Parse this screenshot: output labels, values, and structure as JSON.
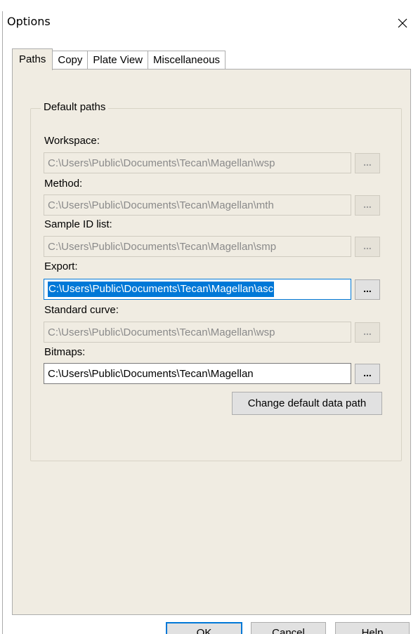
{
  "window": {
    "title": "Options",
    "close_glyph": "✕"
  },
  "tabs": [
    {
      "label": "Paths",
      "active": true
    },
    {
      "label": "Copy",
      "active": false
    },
    {
      "label": "Plate View",
      "active": false
    },
    {
      "label": "Miscellaneous",
      "active": false
    }
  ],
  "group": {
    "label": "Default paths"
  },
  "fields": {
    "workspace": {
      "label": "Workspace:",
      "value": "C:\\Users\\Public\\Documents\\Tecan\\Magellan\\wsp",
      "enabled": false
    },
    "method": {
      "label": "Method:",
      "value": "C:\\Users\\Public\\Documents\\Tecan\\Magellan\\mth",
      "enabled": false
    },
    "sample_id_list": {
      "label": "Sample ID list:",
      "value": "C:\\Users\\Public\\Documents\\Tecan\\Magellan\\smp",
      "enabled": false
    },
    "export": {
      "label": "Export:",
      "value": "C:\\Users\\Public\\Documents\\Tecan\\Magellan\\asc",
      "enabled": true,
      "focused": true
    },
    "standard_curve": {
      "label": "Standard curve:",
      "value": "C:\\Users\\Public\\Documents\\Tecan\\Magellan\\wsp",
      "enabled": false
    },
    "bitmaps": {
      "label": "Bitmaps:",
      "value": "C:\\Users\\Public\\Documents\\Tecan\\Magellan",
      "enabled": true
    }
  },
  "browse_label": "...",
  "change_default_label": "Change default data path",
  "buttons": {
    "ok": "OK",
    "cancel": "Cancel",
    "help": "Help"
  },
  "colors": {
    "tab_page_bg": "#f0ece2",
    "selection_blue": "#0078d7",
    "button_face": "#e1e1e1"
  },
  "icons": {
    "close": "close-icon"
  }
}
